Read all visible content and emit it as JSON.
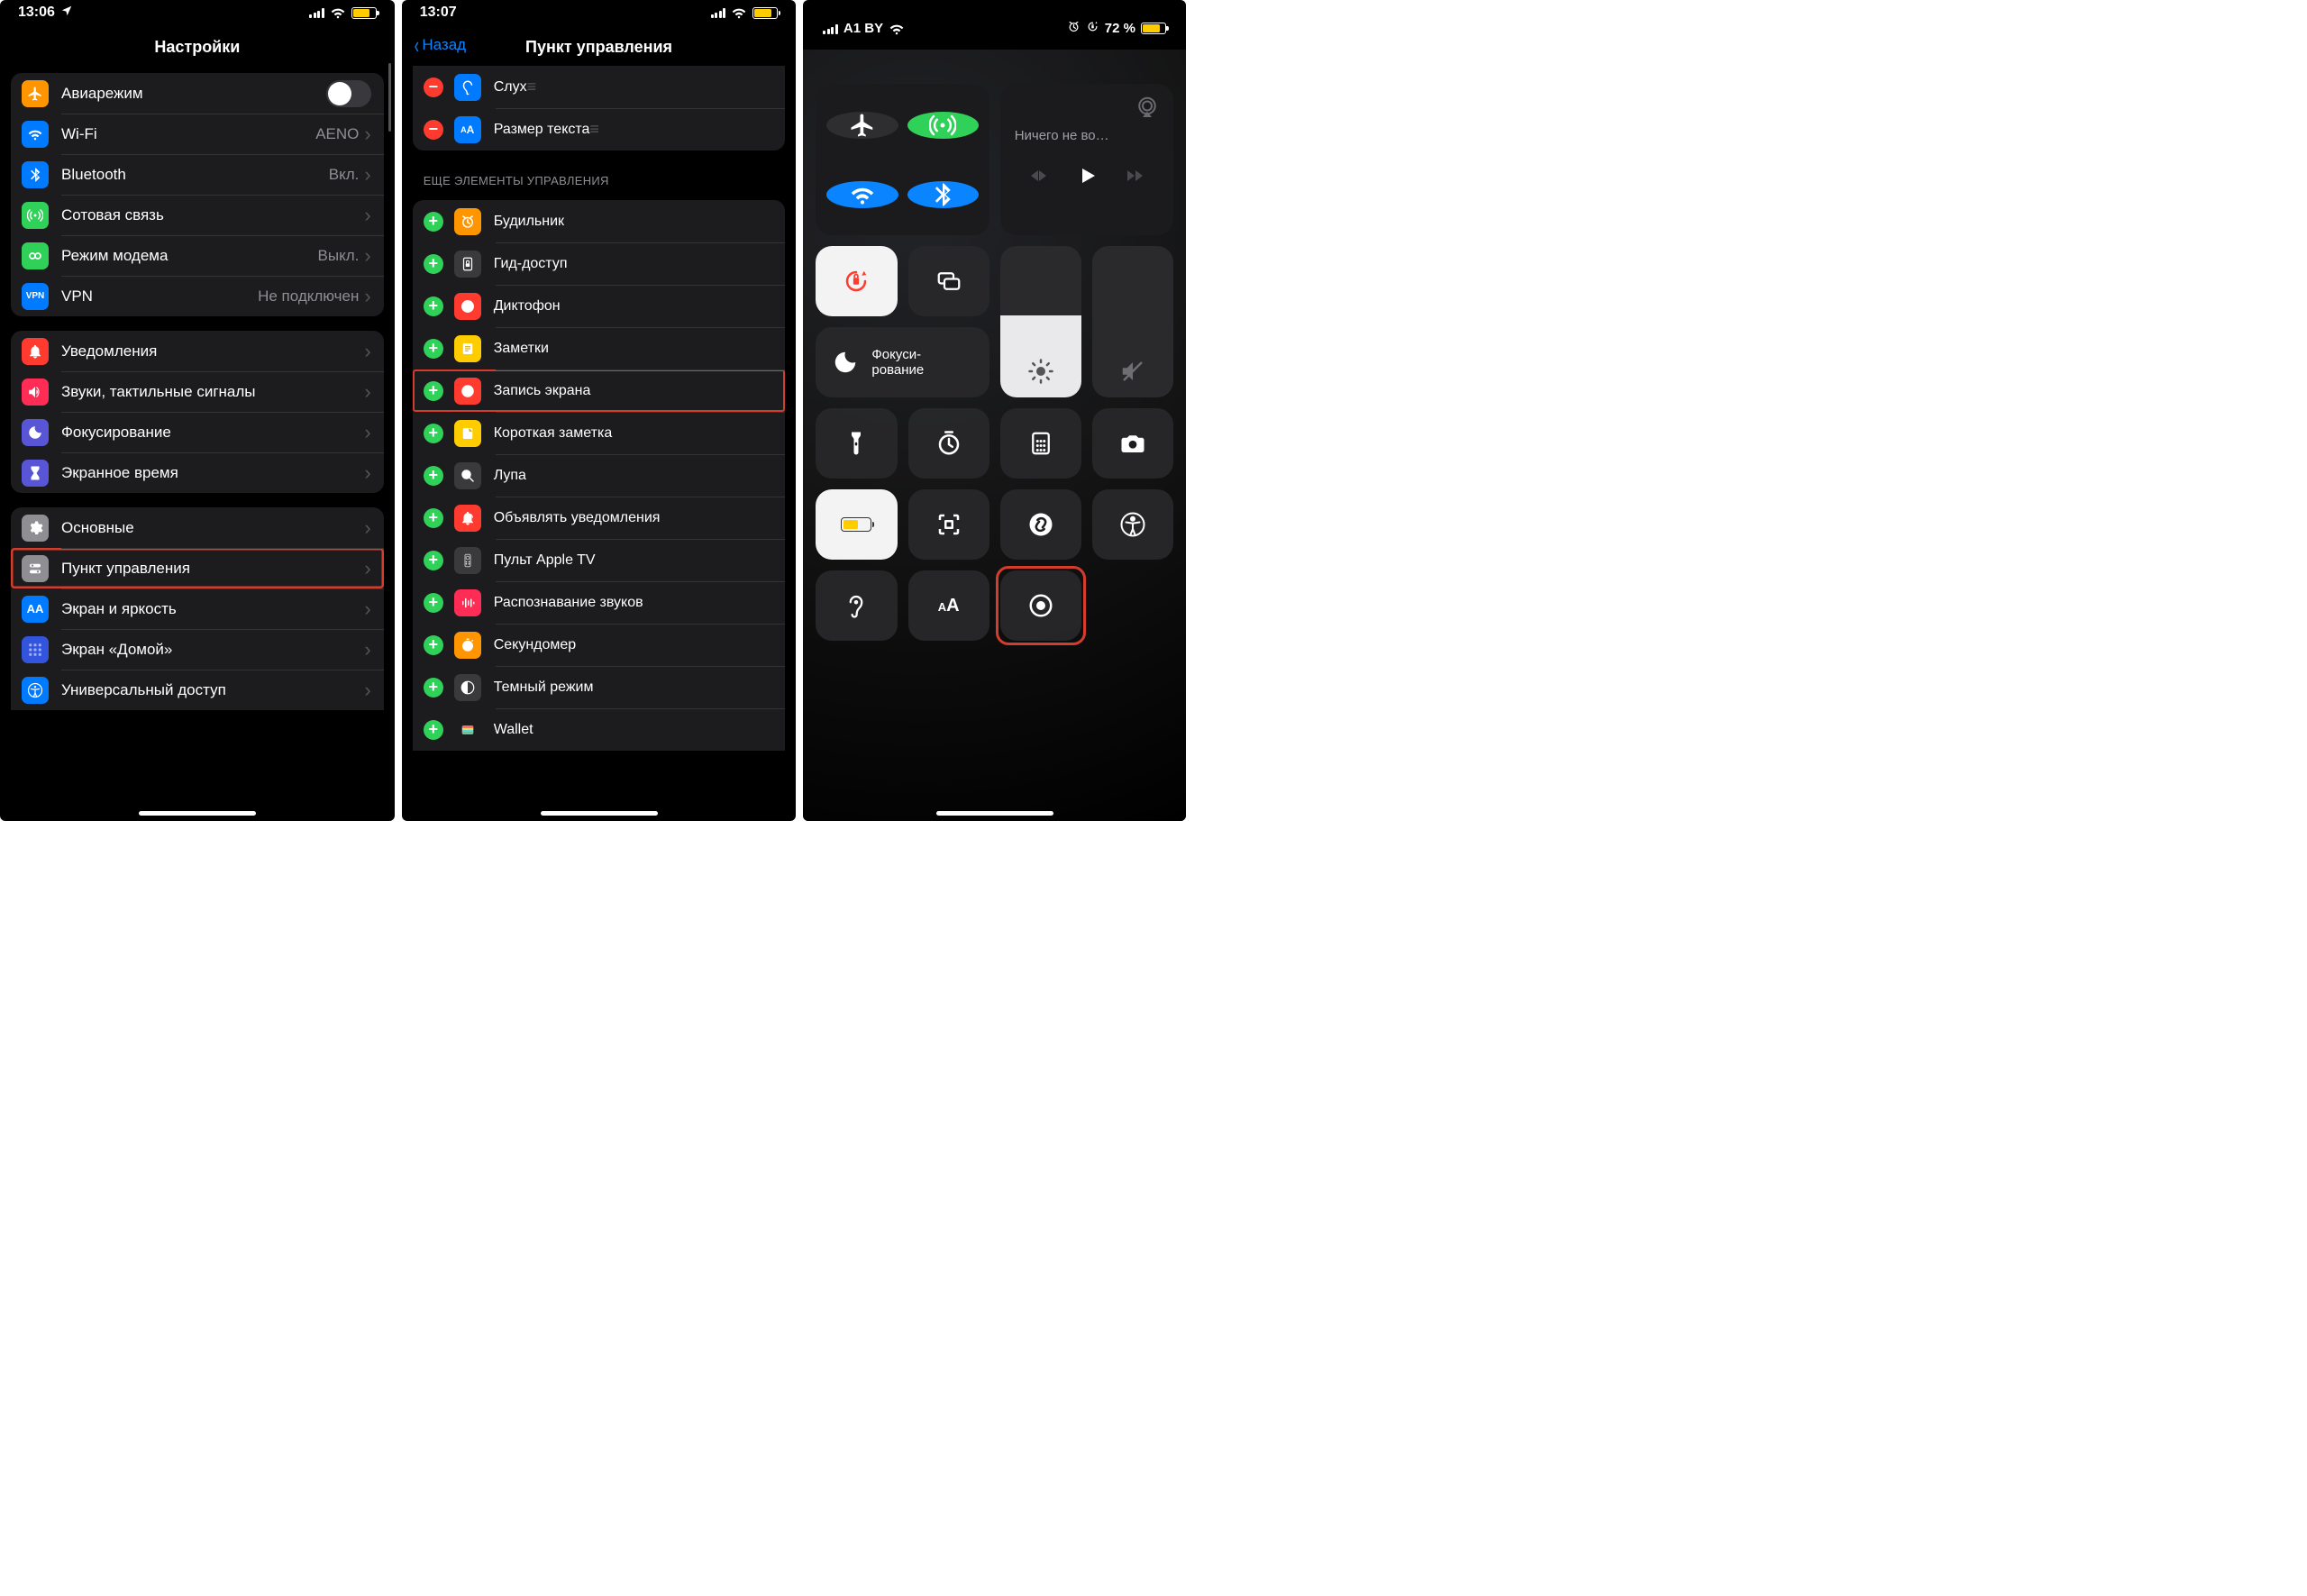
{
  "screen1": {
    "time": "13:06",
    "title": "Настройки",
    "group1": [
      {
        "id": "airplane",
        "label": "Авиарежим",
        "iconBg": "#ff9500",
        "toggle": true
      },
      {
        "id": "wifi",
        "label": "Wi-Fi",
        "value": "AENO",
        "iconBg": "#007aff"
      },
      {
        "id": "bluetooth",
        "label": "Bluetooth",
        "value": "Вкл.",
        "iconBg": "#007aff"
      },
      {
        "id": "cellular",
        "label": "Сотовая связь",
        "iconBg": "#30d158"
      },
      {
        "id": "hotspot",
        "label": "Режим модема",
        "value": "Выкл.",
        "iconBg": "#30d158"
      },
      {
        "id": "vpn",
        "label": "VPN",
        "value": "Не подключен",
        "iconBg": "#007aff"
      }
    ],
    "group2": [
      {
        "id": "notifications",
        "label": "Уведомления",
        "iconBg": "#ff3b30"
      },
      {
        "id": "sounds",
        "label": "Звуки, тактильные сигналы",
        "iconBg": "#ff2d55"
      },
      {
        "id": "focus",
        "label": "Фокусирование",
        "iconBg": "#5856d6"
      },
      {
        "id": "screentime",
        "label": "Экранное время",
        "iconBg": "#5856d6"
      }
    ],
    "group3": [
      {
        "id": "general",
        "label": "Основные",
        "iconBg": "#8e8e93"
      },
      {
        "id": "controlcenter",
        "label": "Пункт управления",
        "iconBg": "#8e8e93",
        "highlight": true
      },
      {
        "id": "display",
        "label": "Экран и яркость",
        "iconBg": "#007aff"
      },
      {
        "id": "homescreen",
        "label": "Экран «Домой»",
        "iconBg": "#3355dd"
      },
      {
        "id": "accessibility",
        "label": "Универсальный доступ",
        "iconBg": "#007aff"
      }
    ]
  },
  "screen2": {
    "time": "13:07",
    "back": "Назад",
    "title": "Пункт управления",
    "included": [
      {
        "id": "hearing",
        "label": "Слух",
        "iconBg": "#007aff"
      },
      {
        "id": "textsize",
        "label": "Размер текста",
        "iconBg": "#007aff"
      }
    ],
    "sectionHeader": "ЕЩЕ ЭЛЕМЕНТЫ УПРАВЛЕНИЯ",
    "more": [
      {
        "id": "alarm",
        "label": "Будильник",
        "iconBg": "#ff9500"
      },
      {
        "id": "guided",
        "label": "Гид-доступ",
        "iconBg": "#3a3a3c"
      },
      {
        "id": "voicememo",
        "label": "Диктофон",
        "iconBg": "#ff3b30"
      },
      {
        "id": "notes",
        "label": "Заметки",
        "iconBg": "#ffcc00"
      },
      {
        "id": "screenrec",
        "label": "Запись экрана",
        "iconBg": "#ff3b30",
        "highlight": true
      },
      {
        "id": "quicknote",
        "label": "Короткая заметка",
        "iconBg": "#ffcc00"
      },
      {
        "id": "magnifier",
        "label": "Лупа",
        "iconBg": "#3a3a3c"
      },
      {
        "id": "announce",
        "label": "Объявлять уведомления",
        "iconBg": "#ff3b30"
      },
      {
        "id": "appletv",
        "label": "Пульт Apple TV",
        "iconBg": "#3a3a3c"
      },
      {
        "id": "soundrec",
        "label": "Распознавание звуков",
        "iconBg": "#ff2d55"
      },
      {
        "id": "stopwatch",
        "label": "Секундомер",
        "iconBg": "#ff9500"
      },
      {
        "id": "darkmode",
        "label": "Темный режим",
        "iconBg": "#3a3a3c"
      },
      {
        "id": "wallet",
        "label": "Wallet",
        "iconBg": "#1c1c1e"
      }
    ]
  },
  "screen3": {
    "carrier": "A1 BY",
    "batteryText": "72 %",
    "batteryIcon": true,
    "mediaTitle": "Ничего не во…",
    "focusLabel": "Фокуси-\nрование",
    "brightnessPct": 54,
    "volumePct": 0,
    "rotationLocked": true
  }
}
